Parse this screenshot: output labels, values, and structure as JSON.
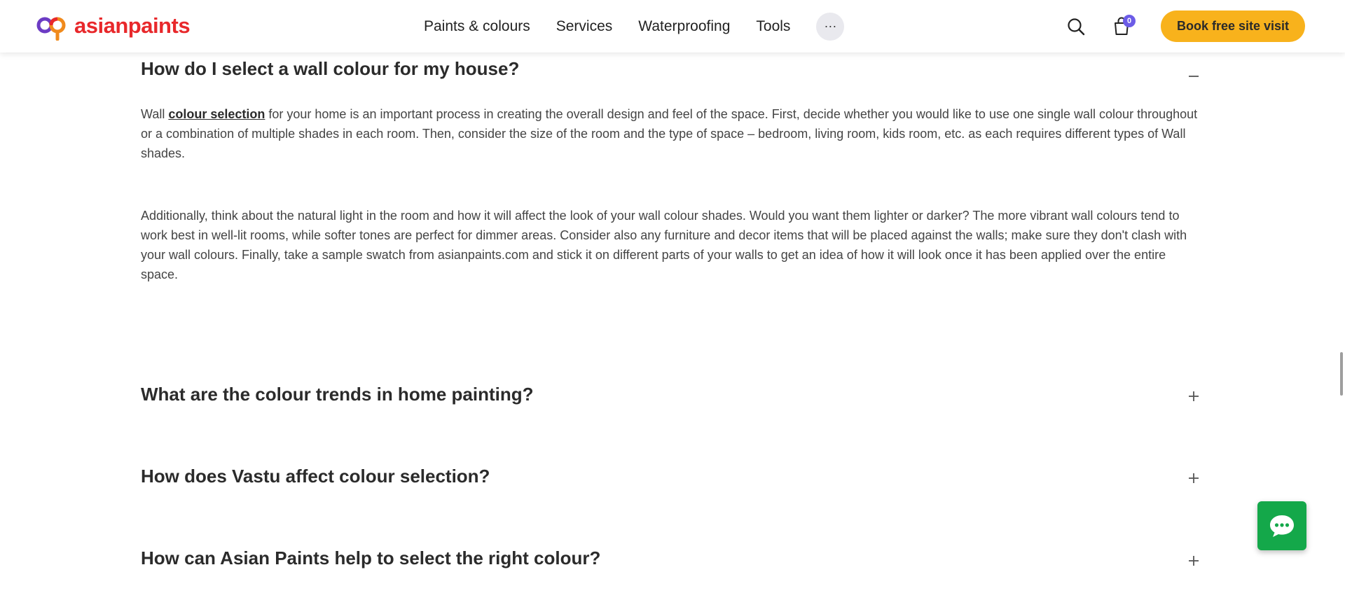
{
  "header": {
    "logo_text": "asianpaints",
    "nav": [
      "Paints & colours",
      "Services",
      "Waterproofing",
      "Tools"
    ],
    "more_label": "···",
    "cart_count": "0",
    "cta_label": "Book free site visit"
  },
  "faq": {
    "items": [
      {
        "question": "How do I select a wall colour for my house?",
        "expanded": true,
        "answer_p1_prefix": "Wall ",
        "answer_p1_link": "colour selection",
        "answer_p1_suffix": " for your home is an important process in creating the overall design and feel of the space. First, decide whether you would like to use one single wall colour throughout or a combination of multiple shades in each room. Then, consider the size of the room and the type of space – bedroom, living room, kids room, etc. as each requires different types of Wall shades.",
        "answer_p2": "Additionally, think about the natural light in the room and how it will affect the look of your wall colour shades. Would you want them lighter or darker? The more vibrant wall colours tend to work best in well-lit rooms, while softer tones are perfect for dimmer areas. Consider also any furniture and decor items that will be placed against the walls; make sure they don't clash with your wall colours. Finally, take a sample swatch from asianpaints.com and stick it on different parts of your walls to get an idea of how it will look once it has been applied over the entire space."
      },
      {
        "question": "What are the colour trends in home painting?",
        "expanded": false
      },
      {
        "question": "How does Vastu affect colour selection?",
        "expanded": false
      },
      {
        "question": "How can Asian Paints help to select the right colour?",
        "expanded": false
      }
    ]
  },
  "colors": {
    "brand": "#e8282b",
    "cta": "#f8b21c",
    "chat": "#14a84a",
    "badge": "#6c5ce7"
  },
  "icons": [
    "asianpaints-logo-icon",
    "search-icon",
    "cart-icon",
    "minus-icon",
    "plus-icon",
    "chat-icon"
  ]
}
